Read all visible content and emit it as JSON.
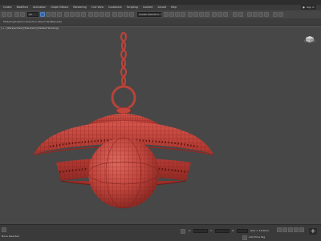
{
  "menu": {
    "items": [
      "Create",
      "Modifiers",
      "Animation",
      "Graph Editors",
      "Rendering",
      "Civil View",
      "Customize",
      "Scripting",
      "Content",
      "Arnold",
      "Help"
    ],
    "signin_label": "Sign In"
  },
  "toolbar": {
    "selection_filter": "All",
    "named_selection_set": "Create Selection Se"
  },
  "ribbon": {
    "tabs": [
      "Modeling",
      "Freeform",
      "Selection",
      "Object Paint",
      "Populate"
    ]
  },
  "viewport": {
    "label": "[ + ] [Perspective] [Standard] [Default Shading]"
  },
  "status": {
    "left_text": "None Selected",
    "x_label": "X:",
    "y_label": "Y:",
    "z_label": "Z:",
    "grid_text": "Grid = 10.0mm",
    "add_time_tag": "Add Time Tag"
  },
  "colors": {
    "accent": "#4f86c6",
    "object": "#c0453d",
    "wire": "#7a1e19"
  }
}
